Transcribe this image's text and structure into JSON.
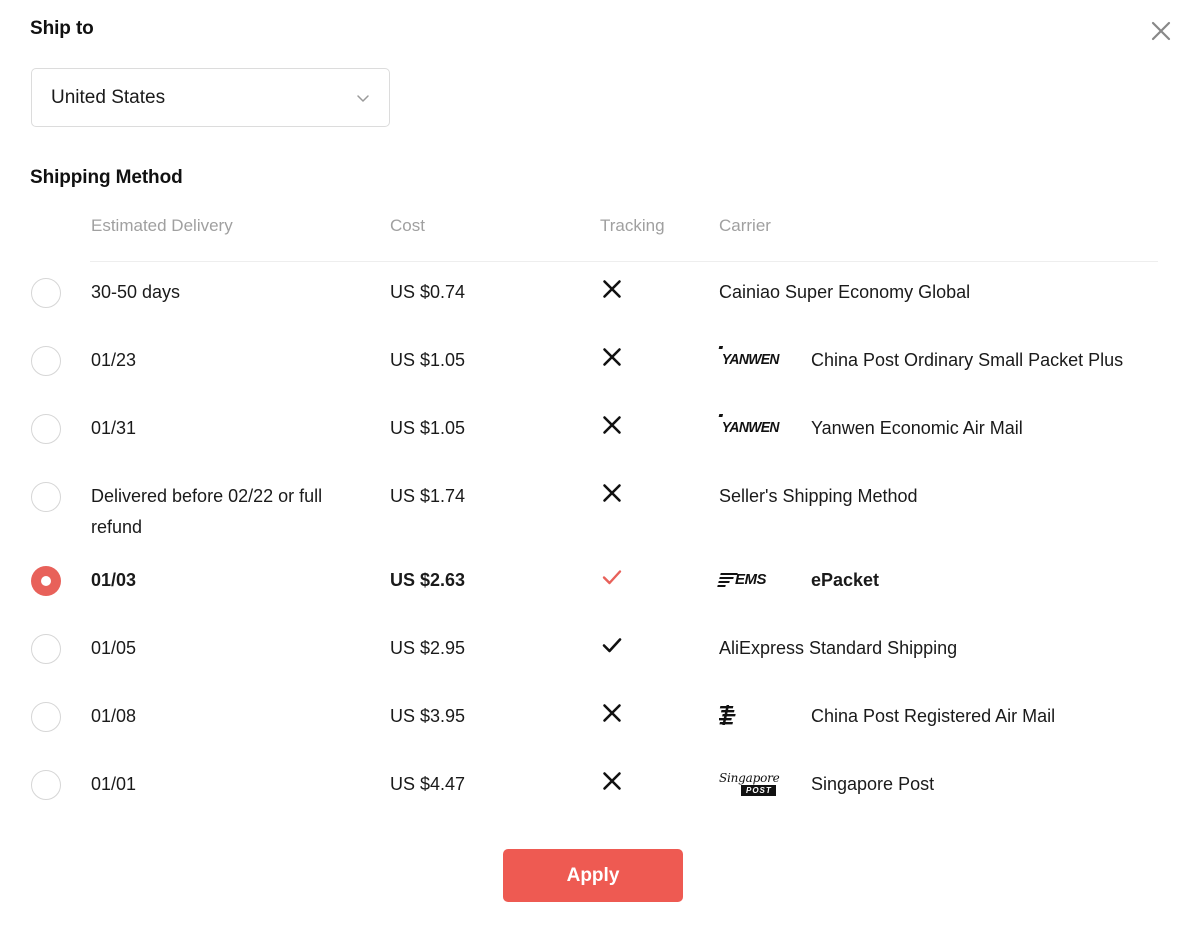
{
  "dialog": {
    "close_icon": "close-icon"
  },
  "ship_to": {
    "title": "Ship to",
    "selected_country": "United States",
    "chevron_icon": "chevron-down-icon"
  },
  "shipping_method": {
    "title": "Shipping Method",
    "columns": {
      "delivery": "Estimated Delivery",
      "cost": "Cost",
      "tracking": "Tracking",
      "carrier": "Carrier"
    },
    "rows": [
      {
        "delivery": "30-50 days",
        "cost": "US $0.74",
        "tracking": "no",
        "carrier": "Cainiao Super Economy Global",
        "logo": "none",
        "selected": false
      },
      {
        "delivery": "01/23",
        "cost": "US $1.05",
        "tracking": "no",
        "carrier": "China Post Ordinary Small Packet Plus",
        "logo": "yanwen",
        "selected": false
      },
      {
        "delivery": "01/31",
        "cost": "US $1.05",
        "tracking": "no",
        "carrier": "Yanwen Economic Air Mail",
        "logo": "yanwen",
        "selected": false
      },
      {
        "delivery": "Delivered before 02/22 or full refund",
        "cost": "US $1.74",
        "tracking": "no",
        "carrier": "Seller's Shipping Method",
        "logo": "none",
        "selected": false
      },
      {
        "delivery": "01/03",
        "cost": "US $2.63",
        "tracking": "yes",
        "carrier": "ePacket",
        "logo": "ems",
        "selected": true
      },
      {
        "delivery": "01/05",
        "cost": "US $2.95",
        "tracking": "yes",
        "carrier": "AliExpress Standard Shipping",
        "logo": "none",
        "selected": false
      },
      {
        "delivery": "01/08",
        "cost": "US $3.95",
        "tracking": "no",
        "carrier": "China Post Registered Air Mail",
        "logo": "chinapost",
        "selected": false
      },
      {
        "delivery": "01/01",
        "cost": "US $4.47",
        "tracking": "no",
        "carrier": "Singapore Post",
        "logo": "sgpost",
        "selected": false
      }
    ],
    "logo_labels": {
      "yanwen": "YANWEN",
      "ems": "EMS",
      "sgpost_script": "Singapore",
      "sgpost_badge": "POST"
    }
  },
  "footer": {
    "apply_label": "Apply"
  },
  "colors": {
    "accent": "#ee5a52",
    "selected_radio": "#e8615a",
    "tracking_yes_selected": "#e8615a",
    "header_text": "#a0a0a0",
    "divider": "#eeeeee"
  }
}
